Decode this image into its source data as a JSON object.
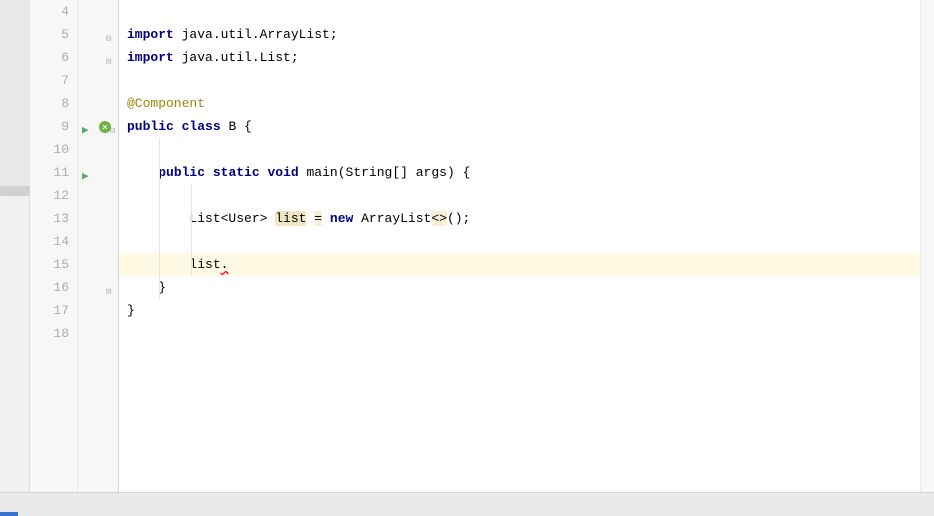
{
  "lines": {
    "l4": "4",
    "l5": "5",
    "l6": "6",
    "l7": "7",
    "l8": "8",
    "l9": "9",
    "l10": "10",
    "l11": "11",
    "l12": "12",
    "l13": "13",
    "l14": "14",
    "l15": "15",
    "l16": "16",
    "l17": "17",
    "l18": "18"
  },
  "code": {
    "l5": {
      "kw": "import",
      "rest": " java.util.ArrayList;"
    },
    "l6": {
      "kw": "import",
      "rest": " java.util.List;"
    },
    "l8": {
      "annotation": "@Component"
    },
    "l9": {
      "kw1": "public",
      "kw2": "class",
      "name": " B ",
      "brace": "{"
    },
    "l11": {
      "kw1": "public",
      "kw2": "static",
      "kw3": "void",
      "method": " main",
      "paren1": "(",
      "type": "String",
      "brackets": "[]",
      "param": " args",
      "paren2": ") ",
      "brace": "{"
    },
    "l13": {
      "pre": "List<User> ",
      "var": "list",
      "sp": " ",
      "eq": "=",
      "sp2": " ",
      "kw": "new",
      "post1": " ArrayList",
      "diamond": "<>",
      "post2": "();"
    },
    "l15": {
      "var": "list",
      "dot": "."
    },
    "l16": {
      "brace": "}"
    },
    "l17": {
      "brace": "}"
    }
  }
}
